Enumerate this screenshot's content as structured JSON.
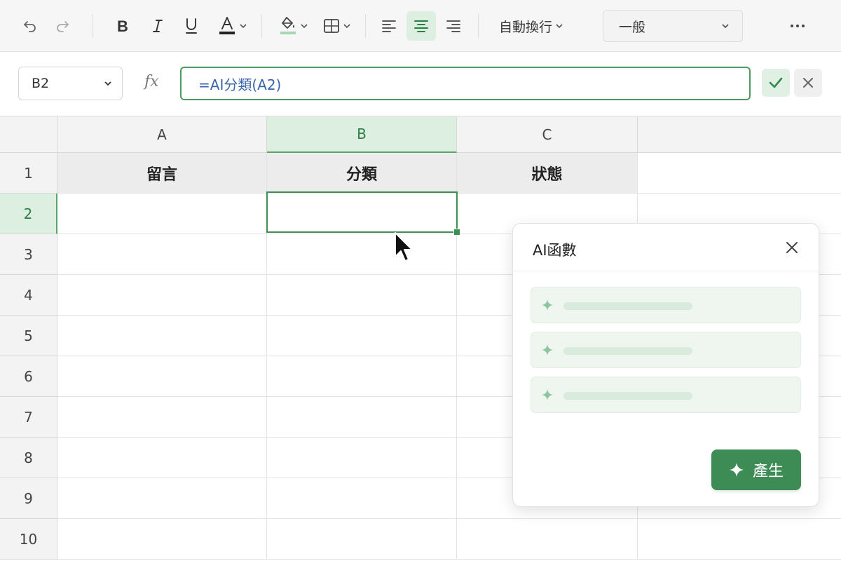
{
  "toolbar": {
    "wrap_label": "自動換行",
    "number_format": "一般",
    "icons": [
      "undo-icon",
      "redo-icon",
      "bold-icon",
      "italic-icon",
      "underline-icon",
      "font-color-icon",
      "fill-color-icon",
      "borders-icon",
      "align-left-icon",
      "align-center-icon",
      "align-right-icon",
      "more-icon"
    ],
    "active_align": "center",
    "accent_color": "#3e8c55",
    "font_color_bar": "#222222",
    "fill_color_bar": "#a9d7b4"
  },
  "formula_bar": {
    "cell_ref": "B2",
    "fx_label": "fx",
    "formula": "=AI分類(A2)"
  },
  "sheet": {
    "columns": [
      "A",
      "B",
      "C"
    ],
    "rows": [
      "1",
      "2",
      "3",
      "4",
      "5",
      "6",
      "7",
      "8",
      "9",
      "10"
    ],
    "selected_cell": "B2",
    "header_row": [
      "留言",
      "分類",
      "狀態"
    ]
  },
  "ai_panel": {
    "title": "AI函數",
    "suggestions_count": 3,
    "generate_label": "產生"
  }
}
